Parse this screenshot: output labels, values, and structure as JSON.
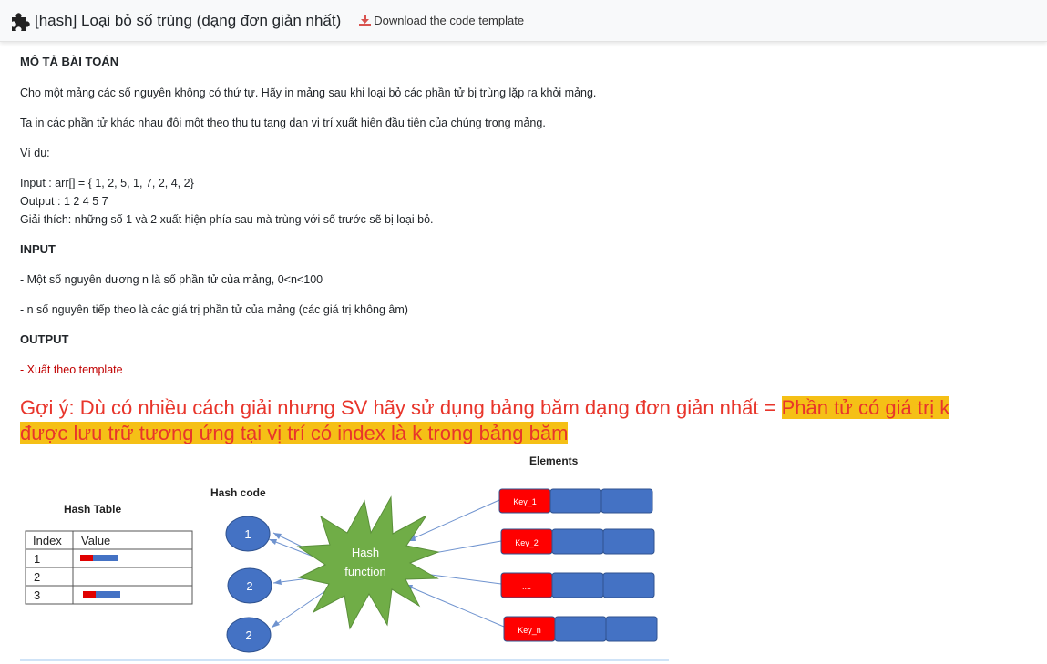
{
  "header": {
    "title": "[hash] Loại bỏ số trùng (dạng đơn giản nhất)",
    "download_label": "Download the code template",
    "puzzle_icon": "puzzle-icon",
    "download_icon": "download-icon",
    "download_color": "#d9534f"
  },
  "problem": {
    "section_title": "MÔ TẢ BÀI TOÁN",
    "desc1": "Cho một mảng các số nguyên không có thứ tự. Hãy in mảng sau khi loại bỏ các phần tử bị trùng lặp ra khỏi mảng.",
    "desc2": "Ta in các phần tử khác nhau đôi một theo thu tu tang dan vị trí xuất hiện đầu tiên của chúng trong mảng.",
    "example_label": "Ví dụ:",
    "example_input": "Input : arr[] = { 1, 2, 5, 1, 7, 2, 4, 2}",
    "example_output": "Output : 1 2 4 5 7",
    "example_explain": "Giải thích: những số 1 và 2 xuất hiện phía sau mà trùng với số trước sẽ bị loại bỏ."
  },
  "input_section": {
    "title": "INPUT",
    "line1": "- Một số nguyên dương n là số phần tử của mảng, 0<n<100",
    "line2": "- n số nguyên tiếp theo là các giá trị phần tử của mảng (các giá trị không âm)"
  },
  "output_section": {
    "title": "OUTPUT",
    "line1": "- Xuất theo template"
  },
  "hint": {
    "plain": "Gợi ý: Dù có nhiều cách giải nhưng SV hãy sử dụng bảng băm dạng đơn giản nhất = ",
    "highlight1": "Phần tử có giá trị k",
    "highlight2": "được lưu trữ tương ứng tại vị trí có index là k trong bảng băm",
    "color": "#e8352b",
    "highlight_color": "#f5c016"
  },
  "diagram": {
    "hash_table_title": "Hash Table",
    "col_index": "Index",
    "col_value": "Value",
    "rows": [
      "1",
      "2",
      "3"
    ],
    "hash_code_title": "Hash code",
    "codes": [
      "1",
      "2",
      "2"
    ],
    "function_label1": "Hash",
    "function_label2": "function",
    "elements_title": "Elements",
    "keys": [
      "Key_1",
      "Key_2",
      "....",
      "Key_n"
    ],
    "colors": {
      "key": "#ff0000",
      "element": "#4472c4",
      "star": "#70ad47"
    }
  }
}
